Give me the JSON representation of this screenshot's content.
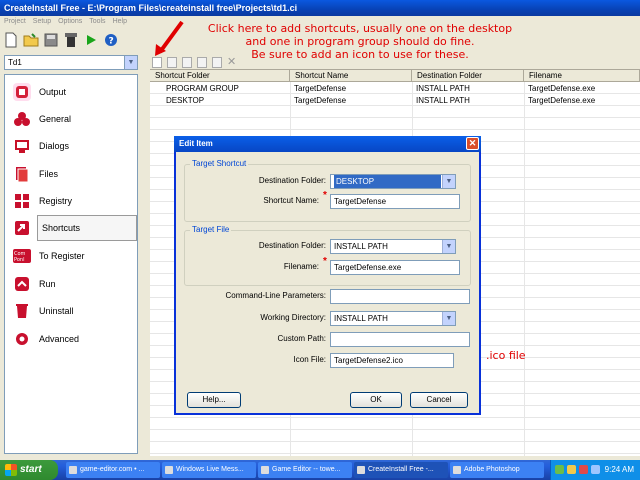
{
  "window": {
    "title": "CreateInstall Free - E:\\Program Files\\createinstall free\\Projects\\td1.ci"
  },
  "menu": [
    "Project",
    "Setup",
    "Options",
    "Tools",
    "Help"
  ],
  "project_select": {
    "value": "Td1"
  },
  "nav": [
    {
      "label": "Output",
      "icon": "output-icon",
      "color": "#d4203a"
    },
    {
      "label": "General",
      "icon": "general-icon",
      "color": "#c8102e"
    },
    {
      "label": "Dialogs",
      "icon": "dialogs-icon",
      "color": "#c81028"
    },
    {
      "label": "Files",
      "icon": "files-icon",
      "color": "#c8102e"
    },
    {
      "label": "Registry",
      "icon": "registry-icon",
      "color": "#c8102e"
    },
    {
      "label": "Shortcuts",
      "icon": "shortcuts-icon",
      "color": "#c8102e"
    },
    {
      "label": "To Register",
      "icon": "to-register-icon",
      "color": "#c8102e"
    },
    {
      "label": "Run",
      "icon": "run-icon",
      "color": "#c8102e"
    },
    {
      "label": "Uninstall",
      "icon": "uninstall-icon",
      "color": "#c8102e"
    },
    {
      "label": "Advanced",
      "icon": "advanced-icon",
      "color": "#c8102e"
    }
  ],
  "grid": {
    "columns": [
      "Shortcut Folder",
      "Shortcut Name",
      "Destination Folder",
      "Filename"
    ],
    "rows": [
      [
        "PROGRAM GROUP",
        "TargetDefense",
        "INSTALL PATH",
        "TargetDefense.exe"
      ],
      [
        "DESKTOP",
        "TargetDefense",
        "INSTALL PATH",
        "TargetDefense.exe"
      ]
    ]
  },
  "annotation": {
    "line1": "Click here to add shortcuts, usually one on the desktop",
    "line2": "and one in program group should do fine.",
    "line3": "Be sure to add an icon to use for these.",
    "ico": ".ico file"
  },
  "dialog": {
    "title": "Edit Item",
    "target_shortcut_group": "Target Shortcut",
    "dest_folder_label": "Destination Folder:",
    "dest_folder_value": "DESKTOP",
    "shortcut_name_label": "Shortcut Name:",
    "shortcut_name_value": "TargetDefense",
    "target_file_group": "Target File",
    "file_dest_folder_label": "Destination Folder:",
    "file_dest_folder_value": "INSTALL PATH",
    "filename_label": "Filename:",
    "filename_value": "TargetDefense.exe",
    "cmdline_label": "Command-Line Parameters:",
    "cmdline_value": "",
    "workdir_label": "Working Directory:",
    "workdir_value": "INSTALL PATH",
    "custom_path_label": "Custom Path:",
    "custom_path_value": "",
    "icon_file_label": "Icon File:",
    "icon_file_value": "TargetDefense2.ico",
    "help_button": "Help...",
    "ok_button": "OK",
    "cancel_button": "Cancel"
  },
  "taskbar": {
    "start": "start",
    "tasks": [
      "game-editor.com • ...",
      "Windows Live Mess...",
      "Game Editor -- towe...",
      "CreateInstall Free -...",
      "Adobe Photoshop"
    ],
    "clock": "9:24 AM"
  }
}
